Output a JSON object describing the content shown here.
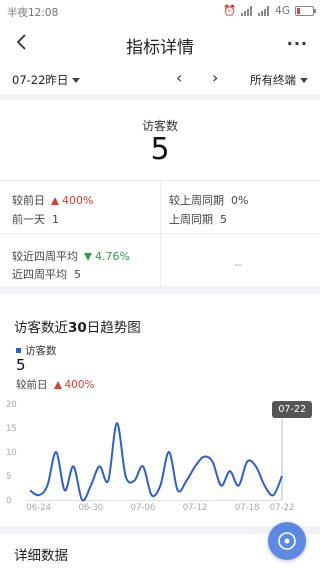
{
  "status_bar": {
    "time_text": "半夜12:08",
    "network": "4G"
  },
  "header": {
    "title": "指标详情",
    "more_label": "···"
  },
  "filters": {
    "date_label": "07-22昨日",
    "terminal_label": "所有终端"
  },
  "summary": {
    "label": "访客数",
    "value": "5",
    "prev_day_label": "较前日",
    "prev_day_change": "400%",
    "last_week_label": "较上周同期",
    "last_week_change": "0%",
    "day_before_label": "前一天",
    "day_before_value": "1",
    "last_week_same_label": "上周同期",
    "last_week_same_value": "5",
    "four_week_label": "较近四周平均",
    "four_week_change": "4.76%",
    "four_week_avg_label": "近四周平均",
    "four_week_avg_value": "5",
    "placeholder": "--"
  },
  "trend": {
    "title_prefix": "访客数近",
    "title_bold": "30",
    "title_suffix": "日趋势图",
    "legend_label": "访客数",
    "value": "5",
    "compare_label": "较前日",
    "compare_change": "400%",
    "tooltip_label": "07-22"
  },
  "detail": {
    "title": "详细数据"
  },
  "colors": {
    "accent": "#2a5fd6",
    "up": "#e53935",
    "down": "#2e9e48"
  },
  "chart_data": {
    "type": "line",
    "x": [
      "06-23",
      "06-24",
      "06-25",
      "06-26",
      "06-27",
      "06-28",
      "06-29",
      "06-30",
      "07-01",
      "07-02",
      "07-03",
      "07-04",
      "07-05",
      "07-06",
      "07-07",
      "07-08",
      "07-09",
      "07-10",
      "07-11",
      "07-12",
      "07-13",
      "07-14",
      "07-15",
      "07-16",
      "07-17",
      "07-18",
      "07-19",
      "07-20",
      "07-21",
      "07-22"
    ],
    "tick_labels": [
      "06-24",
      "06-30",
      "07-06",
      "07-12",
      "07-18",
      "07-22"
    ],
    "series": [
      {
        "name": "访客数",
        "values": [
          2,
          1,
          3,
          10,
          2,
          7,
          0,
          3,
          7,
          4,
          16,
          5,
          4,
          7,
          1,
          3,
          10,
          2,
          4,
          7,
          9,
          8,
          3,
          6,
          3,
          8,
          7,
          3,
          1,
          5
        ]
      }
    ],
    "ylim": [
      0,
      20
    ],
    "yticks": [
      0,
      5,
      10,
      15,
      20
    ],
    "grid": false
  }
}
